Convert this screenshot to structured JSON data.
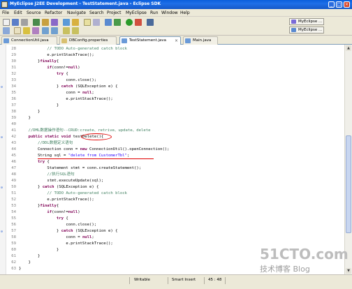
{
  "window": {
    "title": "MyEclipse J2EE Development - TestStatement.java - Eclipse SDK",
    "controls": [
      "_",
      "□",
      "×"
    ]
  },
  "menu": [
    "File",
    "Edit",
    "Source",
    "Refactor",
    "Navigate",
    "Search",
    "Project",
    "MyEclipse",
    "Run",
    "Window",
    "Help"
  ],
  "perspectives": [
    "MyEclipse ...",
    "MyEclipse ..."
  ],
  "tabs": [
    {
      "label": "ConnectionUtil.java",
      "active": false,
      "icon": "java-file-icon"
    },
    {
      "label": "DBConfig.properties",
      "active": false,
      "icon": "properties-file-icon"
    },
    {
      "label": "TestStatement.java",
      "active": true,
      "icon": "java-file-icon"
    },
    {
      "label": "Main.java",
      "active": false,
      "icon": "java-file-icon"
    }
  ],
  "editor": {
    "lines": [
      {
        "n": "28",
        "text": "            // TODO Auto-generated catch block"
      },
      {
        "n": "29",
        "text": "            e.printStackTrace();"
      },
      {
        "n": "30",
        "text": "        }finally{"
      },
      {
        "n": "31",
        "text": "            if(conn!=null)"
      },
      {
        "n": "32",
        "text": "                try {"
      },
      {
        "n": "33",
        "text": "                    conn.close();"
      },
      {
        "n": "34",
        "text": "                } catch (SQLException e) {"
      },
      {
        "n": "35",
        "text": "                    conn = null;"
      },
      {
        "n": "36",
        "text": "                    e.printStackTrace();"
      },
      {
        "n": "37",
        "text": "                }"
      },
      {
        "n": "38",
        "text": "        }"
      },
      {
        "n": "39",
        "text": "    }"
      },
      {
        "n": "40",
        "text": ""
      },
      {
        "n": "41",
        "text": "    //DML数据操作语句--CRUD:create、retrive、update、delete"
      },
      {
        "n": "42",
        "text": "    public static void testDelete(){"
      },
      {
        "n": "43",
        "text": "        //DDL数据定义语句"
      },
      {
        "n": "44",
        "text": "        Connection conn = new ConnectionUtil().openConnection();"
      },
      {
        "n": "45",
        "text": "        String sql = \"delete from CustomerTbl\";"
      },
      {
        "n": "46",
        "text": "        try {"
      },
      {
        "n": "47",
        "text": "            Statement stmt = conn.createStatement();"
      },
      {
        "n": "48",
        "text": "            //执行SQL语句"
      },
      {
        "n": "49",
        "text": "            stmt.executeUpdate(sql);"
      },
      {
        "n": "50",
        "text": "        } catch (SQLException e) {"
      },
      {
        "n": "51",
        "text": "            // TODO Auto-generated catch block"
      },
      {
        "n": "52",
        "text": "            e.printStackTrace();"
      },
      {
        "n": "53",
        "text": "        }finally{"
      },
      {
        "n": "54",
        "text": "            if(conn!=null)"
      },
      {
        "n": "55",
        "text": "                try {"
      },
      {
        "n": "56",
        "text": "                    conn.close();"
      },
      {
        "n": "57",
        "text": "                } catch (SQLException e) {"
      },
      {
        "n": "58",
        "text": "                    conn = null;"
      },
      {
        "n": "59",
        "text": "                    e.printStackTrace();"
      },
      {
        "n": "60",
        "text": "                }"
      },
      {
        "n": "61",
        "text": "        }"
      },
      {
        "n": "62",
        "text": "    }"
      },
      {
        "n": "63",
        "text": "}"
      }
    ]
  },
  "status": {
    "writable": "Writable",
    "insert_mode": "Smart Insert",
    "position": "45 : 48"
  },
  "watermark": {
    "site": "51CTO.com",
    "sub": "技术博客  Blog"
  },
  "colors": {
    "keyword": "#7f0055",
    "comment": "#3f7f5f",
    "string": "#2a00ff",
    "annotation_red": "#e00000"
  }
}
